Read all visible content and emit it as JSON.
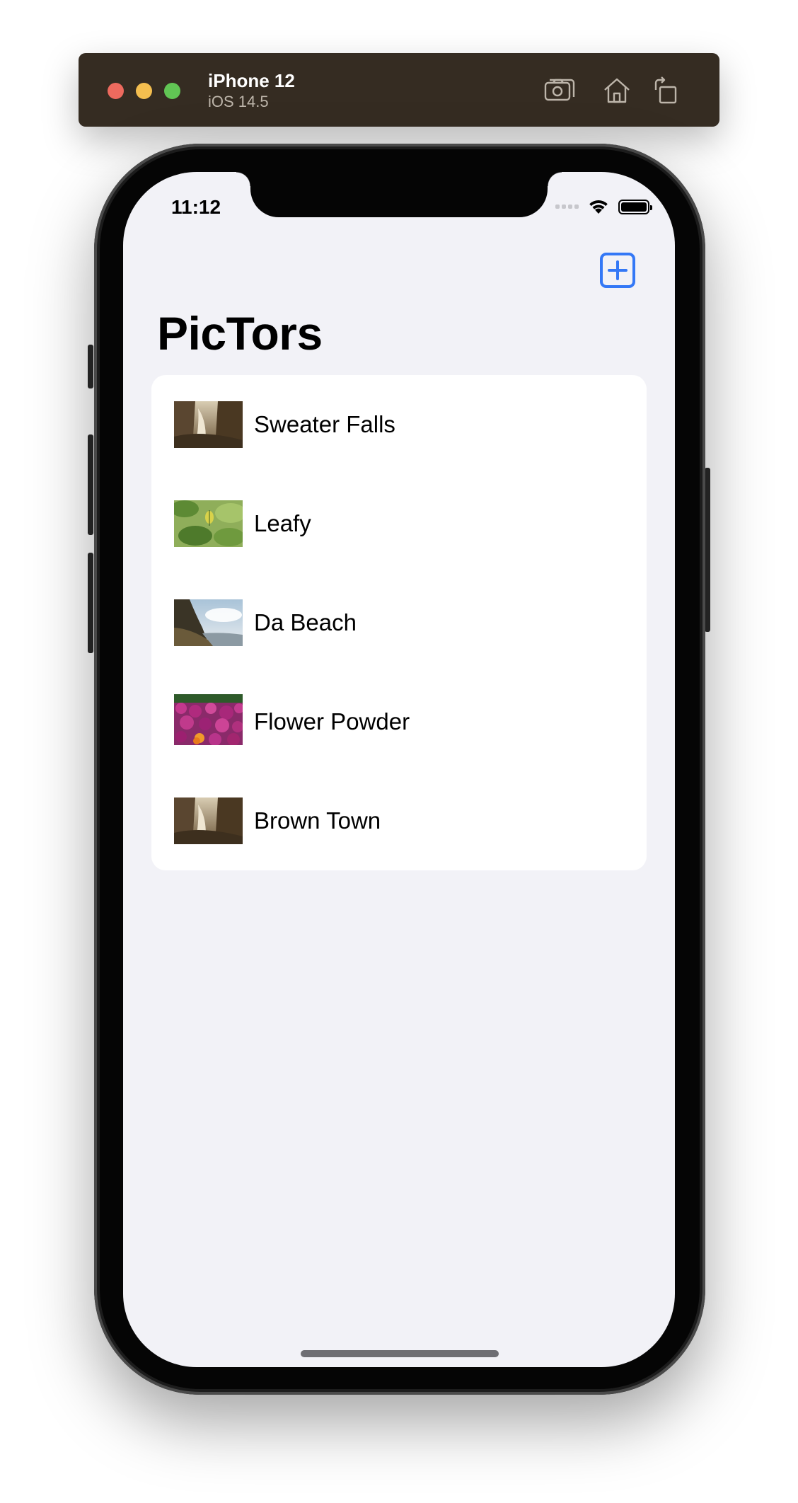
{
  "simulator": {
    "device_name": "iPhone 12",
    "os_version": "iOS 14.5",
    "buttons": [
      {
        "name": "screenshot-icon"
      },
      {
        "name": "home-icon"
      },
      {
        "name": "rotate-icon"
      }
    ]
  },
  "status_bar": {
    "time": "11:12",
    "icons": [
      "signal-icon",
      "wifi-icon",
      "battery-icon"
    ]
  },
  "navigation": {
    "title": "PicTors",
    "add_button_icon": "plus-square-icon",
    "accent_color": "#3478f6"
  },
  "list": {
    "items": [
      {
        "label": "Sweater Falls",
        "thumbnail": "waterfall-sepia"
      },
      {
        "label": "Leafy",
        "thumbnail": "green-leaves"
      },
      {
        "label": "Da Beach",
        "thumbnail": "coastal-cliffs"
      },
      {
        "label": "Flower Powder",
        "thumbnail": "magenta-flowers"
      },
      {
        "label": "Brown Town",
        "thumbnail": "waterfall-sepia"
      }
    ]
  }
}
